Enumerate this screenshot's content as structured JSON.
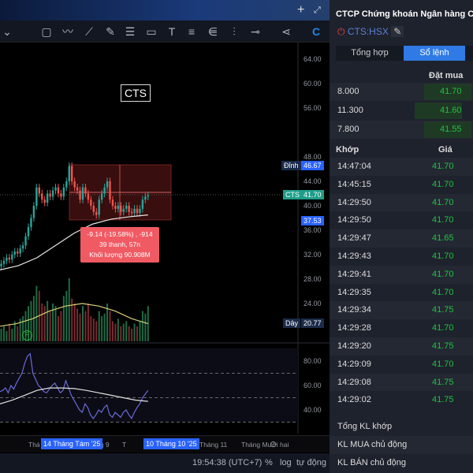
{
  "toolbar": {
    "icons": [
      "rectangle-icon",
      "path-icon",
      "trendline-icon",
      "brush-icon",
      "fib-icon",
      "comment-icon",
      "text-icon",
      "lines-icon",
      "pitchfork-icon",
      "vertical-line-icon",
      "horizontal-line-icon",
      "share-icon",
      "logo-icon"
    ],
    "add": "+"
  },
  "chart": {
    "symbol_label": "CTS",
    "axis_ticks": [
      "64.00",
      "60.00",
      "56.00",
      "48.00",
      "44.00",
      "40.00",
      "36.00",
      "32.00",
      "28.00",
      "24.00"
    ],
    "osc_ticks": [
      "80.00",
      "60.00",
      "40.00"
    ],
    "peak_label": "Đỉnh",
    "peak_value": "46.67",
    "last_label": "CTS",
    "last_value": "41.70",
    "low_value": "37.53",
    "vol_label": "Dây",
    "vol_value": "20.77",
    "measure": {
      "line1": "-9.14 (-19.58%) , -914",
      "line2": "39 thanh, 57n",
      "line3": "Khối lượng 90.908M"
    },
    "flag": "F",
    "closes": [
      30.5,
      31,
      31.5,
      31.2,
      32,
      32.5,
      32.2,
      33,
      33.5,
      35,
      36.5,
      38,
      40,
      43,
      42,
      41,
      40.5,
      42,
      41.5,
      42.5,
      43,
      42,
      41.5,
      43,
      44,
      46.5,
      44,
      43,
      42.5,
      41,
      43,
      42,
      41,
      40,
      39,
      38.5,
      41,
      42,
      43,
      44,
      41,
      40,
      39.5,
      40,
      39,
      39.5,
      40,
      39,
      38.8,
      39.5,
      38.8,
      39.5,
      41,
      41.5,
      41.7
    ],
    "volumes": [
      5,
      6,
      4,
      7,
      5,
      8,
      6,
      9,
      10,
      12,
      14,
      16,
      18,
      22,
      20,
      15,
      14,
      16,
      12,
      15,
      14,
      10,
      12,
      18,
      20,
      25,
      17,
      15,
      13,
      11,
      14,
      12,
      15,
      10,
      9,
      8,
      12,
      10,
      11,
      15,
      12,
      8,
      7,
      9,
      6,
      7,
      8,
      6,
      5,
      7,
      6,
      8,
      12,
      11,
      14
    ],
    "ma": [
      29.5,
      30.2,
      31.5,
      33.5,
      35.5,
      37,
      37.8,
      38.2,
      38.5
    ],
    "vol_ma": [
      6,
      7,
      9,
      12,
      14,
      15,
      14,
      12,
      9,
      7
    ],
    "rsi": [
      55,
      56,
      58,
      54,
      60,
      57,
      62,
      66,
      70,
      78,
      84,
      86,
      70,
      65,
      60,
      58,
      55,
      54,
      57,
      60,
      62,
      58,
      54,
      56,
      64,
      58,
      52,
      48,
      44,
      40,
      38,
      45,
      42,
      36,
      33,
      36,
      40,
      38,
      42,
      44,
      36,
      34,
      38,
      36,
      34,
      38,
      40,
      36,
      33,
      38,
      42,
      45,
      50,
      53,
      56
    ],
    "rsi_ma": [
      45,
      48,
      52,
      56,
      58,
      58,
      57.5,
      56,
      54,
      52,
      50,
      48,
      47
    ]
  },
  "time_axis": {
    "labels": [
      "Thá",
      "ng 9",
      "T",
      "Tháng 11",
      "Tháng Mười hai"
    ],
    "marker1": "14 Tháng Tám '25",
    "marker2": "10 Tháng 10 '25"
  },
  "status": {
    "time": "19:54:38 (UTC+7)",
    "percent": "%",
    "log": "log",
    "auto": "tự động"
  },
  "panel": {
    "title": "CTCP Chứng khoán Ngân hàng C",
    "symbol": "CTS:HSX",
    "tabs": [
      "Tổng hợp",
      "Sổ lệnh"
    ],
    "bid_header": "Đặt mua",
    "bids": [
      {
        "vol": "8.000",
        "price": "41.70"
      },
      {
        "vol": "11.300",
        "price": "41.60"
      },
      {
        "vol": "7.800",
        "price": "41.55"
      }
    ],
    "match_header": "Khớp",
    "price_header": "Giá",
    "trades": [
      {
        "t": "14:47:04",
        "p": "41.70"
      },
      {
        "t": "14:45:15",
        "p": "41.70"
      },
      {
        "t": "14:29:50",
        "p": "41.70"
      },
      {
        "t": "14:29:50",
        "p": "41.70"
      },
      {
        "t": "14:29:47",
        "p": "41.65"
      },
      {
        "t": "14:29:43",
        "p": "41.70"
      },
      {
        "t": "14:29:41",
        "p": "41.70"
      },
      {
        "t": "14:29:35",
        "p": "41.70"
      },
      {
        "t": "14:29:34",
        "p": "41.75"
      },
      {
        "t": "14:29:28",
        "p": "41.70"
      },
      {
        "t": "14:29:20",
        "p": "41.75"
      },
      {
        "t": "14:29:09",
        "p": "41.70"
      },
      {
        "t": "14:29:08",
        "p": "41.75"
      },
      {
        "t": "14:29:02",
        "p": "41.75"
      }
    ],
    "summary": [
      "Tổng KL khớp",
      "KL MUA chủ động",
      "KL BÁN chủ động"
    ]
  }
}
